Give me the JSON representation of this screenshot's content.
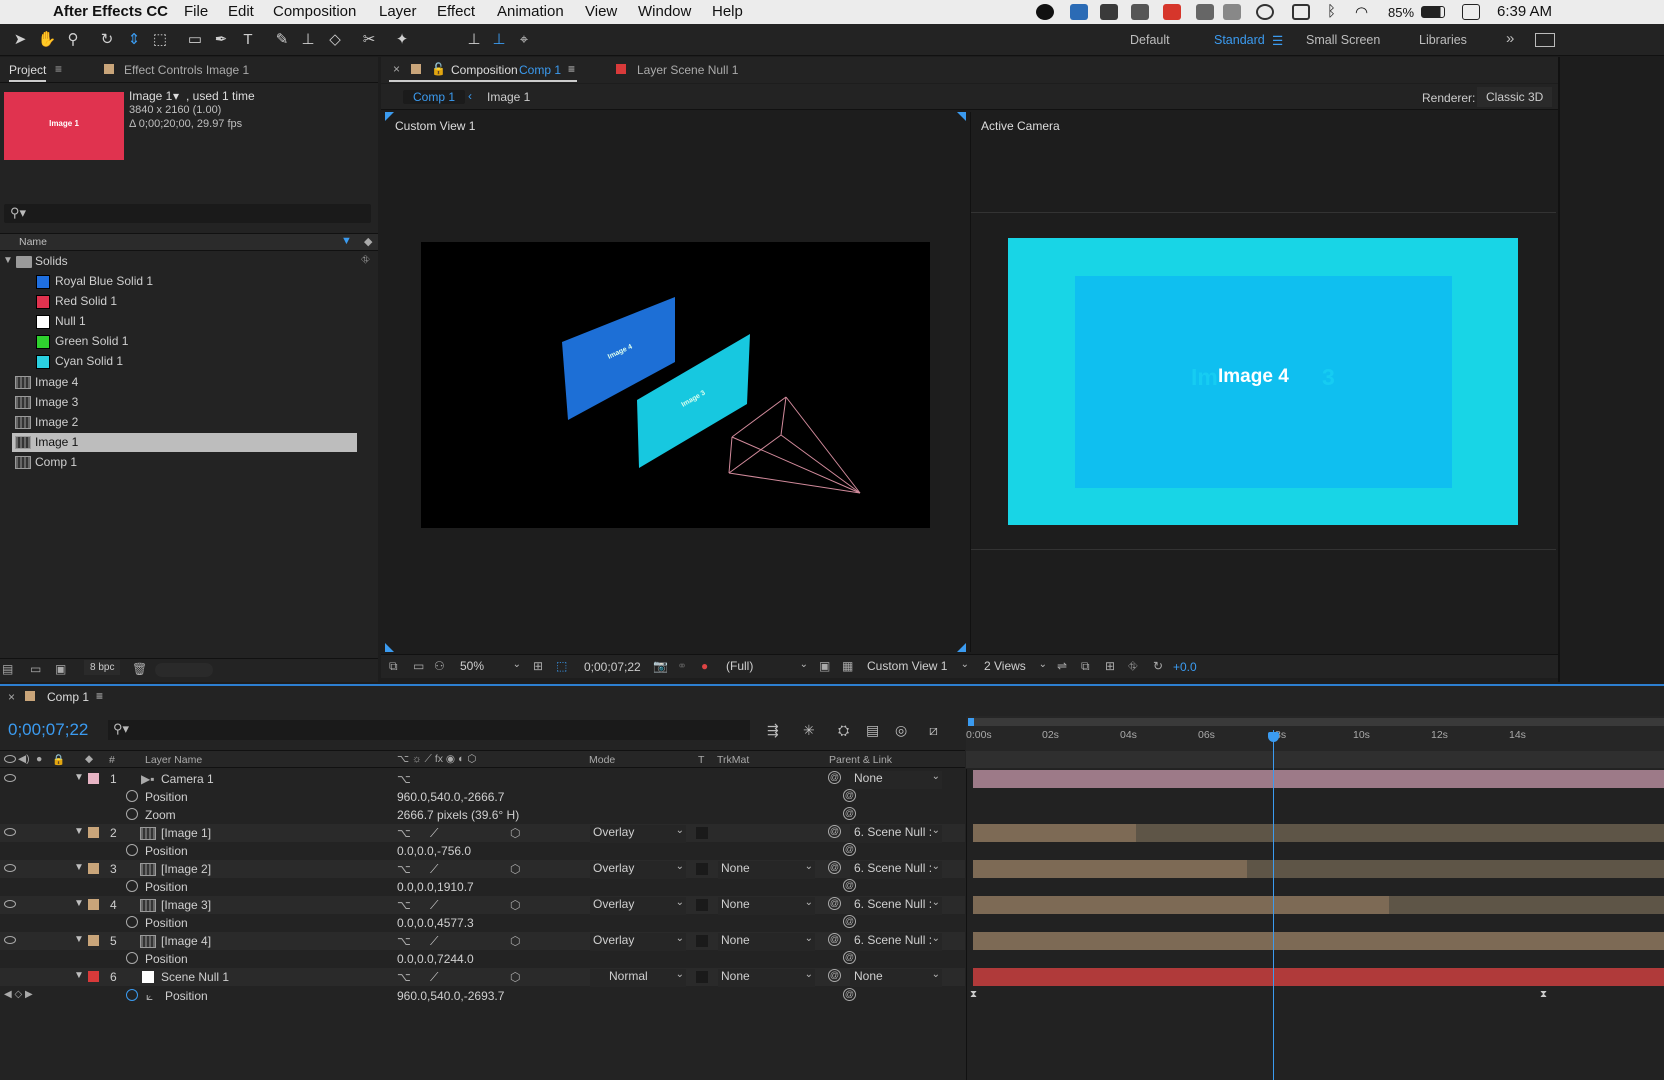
{
  "menubar": {
    "apple": "",
    "app_name": "After Effects CC",
    "items": [
      "File",
      "Edit",
      "Composition",
      "Layer",
      "Effect",
      "Animation",
      "View",
      "Window",
      "Help"
    ],
    "battery": "85%",
    "time": "6:39 AM"
  },
  "workspaces": [
    "Default",
    "Standard",
    "Small Screen",
    "Libraries"
  ],
  "active_workspace": "Standard",
  "project_panel": {
    "tab_project": "Project",
    "tab_effect_controls": "Effect Controls Image 1",
    "thumb_text": "Image 1",
    "info_name": "Image 1",
    "info_used": ", used 1 time",
    "info_dims": "3840 x 2160 (1.00)",
    "info_duration": "Δ 0;00;20;00, 29.97 fps",
    "name_header": "Name",
    "folder": "Solids",
    "solids": [
      {
        "label": "Royal Blue Solid 1",
        "color": "#1f6fe0"
      },
      {
        "label": "Red Solid 1",
        "color": "#e0334f"
      },
      {
        "label": "Null 1",
        "color": "#ffffff"
      },
      {
        "label": "Green Solid 1",
        "color": "#2fd12f"
      },
      {
        "label": "Cyan Solid 1",
        "color": "#2ad0e0"
      }
    ],
    "items": [
      "Image 4",
      "Image 3",
      "Image 2",
      "Image 1",
      "Comp 1"
    ],
    "selected_item": "Image 1",
    "bpc": "8 bpc"
  },
  "composition_panel": {
    "tab_title_prefix": "Composition",
    "tab_comp": "Comp 1",
    "tab_layer": "Layer Scene Null 1",
    "breadcrumb_comp": "Comp 1",
    "breadcrumb_layer": "Image 1",
    "renderer_label": "Renderer:",
    "renderer_value": "Classic 3D",
    "view_left": "Custom View 1",
    "view_right": "Active Camera",
    "image4_label": "Image 4",
    "image3_label": "Image 3",
    "active_text": "Image 4",
    "active_ghost": "Im",
    "active_ghost2": "3",
    "zoom": "50%",
    "timecode": "0;00;07;22",
    "resolution": "(Full)",
    "view_select": "Custom View 1",
    "views_select": "2 Views",
    "exposure": "+0.0"
  },
  "timeline": {
    "tab": "Comp 1",
    "current_time": "0;00;07;22",
    "headers": {
      "num": "#",
      "layer_name": "Layer Name",
      "mode": "Mode",
      "t": "T",
      "trkmat": "TrkMat",
      "parent": "Parent & Link"
    },
    "ruler": [
      "0:00s",
      "02s",
      "04s",
      "06s",
      "",
      "10s",
      "12s",
      "14s"
    ],
    "ruler_playhead_label": "8s",
    "layers": [
      {
        "num": "1",
        "name": "Camera 1",
        "label_color": "#e7b4c4",
        "mode": "",
        "trkmat": "",
        "parent": "None",
        "prop1": "Position",
        "val1": "960.0,540.0,-2666.7",
        "prop2": "Zoom",
        "val2": "2666.7 pixels (39.6° H)"
      },
      {
        "num": "2",
        "name": "[Image 1]",
        "label_color": "#c9a57a",
        "mode": "Overlay",
        "trkmat": "",
        "parent": "6. Scene Null :",
        "prop1": "Position",
        "val1": "0.0,0.0,-756.0"
      },
      {
        "num": "3",
        "name": "[Image 2]",
        "label_color": "#c9a57a",
        "mode": "Overlay",
        "trkmat": "None",
        "parent": "6. Scene Null :",
        "prop1": "Position",
        "val1": "0.0,0.0,1910.7"
      },
      {
        "num": "4",
        "name": "[Image 3]",
        "label_color": "#c9a57a",
        "mode": "Overlay",
        "trkmat": "None",
        "parent": "6. Scene Null :",
        "prop1": "Position",
        "val1": "0.0,0.0,4577.3"
      },
      {
        "num": "5",
        "name": "[Image 4]",
        "label_color": "#c9a57a",
        "mode": "Overlay",
        "trkmat": "None",
        "parent": "6. Scene Null :",
        "prop1": "Position",
        "val1": "0.0,0.0,7244.0"
      },
      {
        "num": "6",
        "name": "Scene Null 1",
        "label_color": "#d83a3a",
        "mode": "Normal",
        "trkmat": "None",
        "parent": "None",
        "prop1": "Position",
        "val1": "960.0,540.0,-2693.7"
      }
    ]
  }
}
